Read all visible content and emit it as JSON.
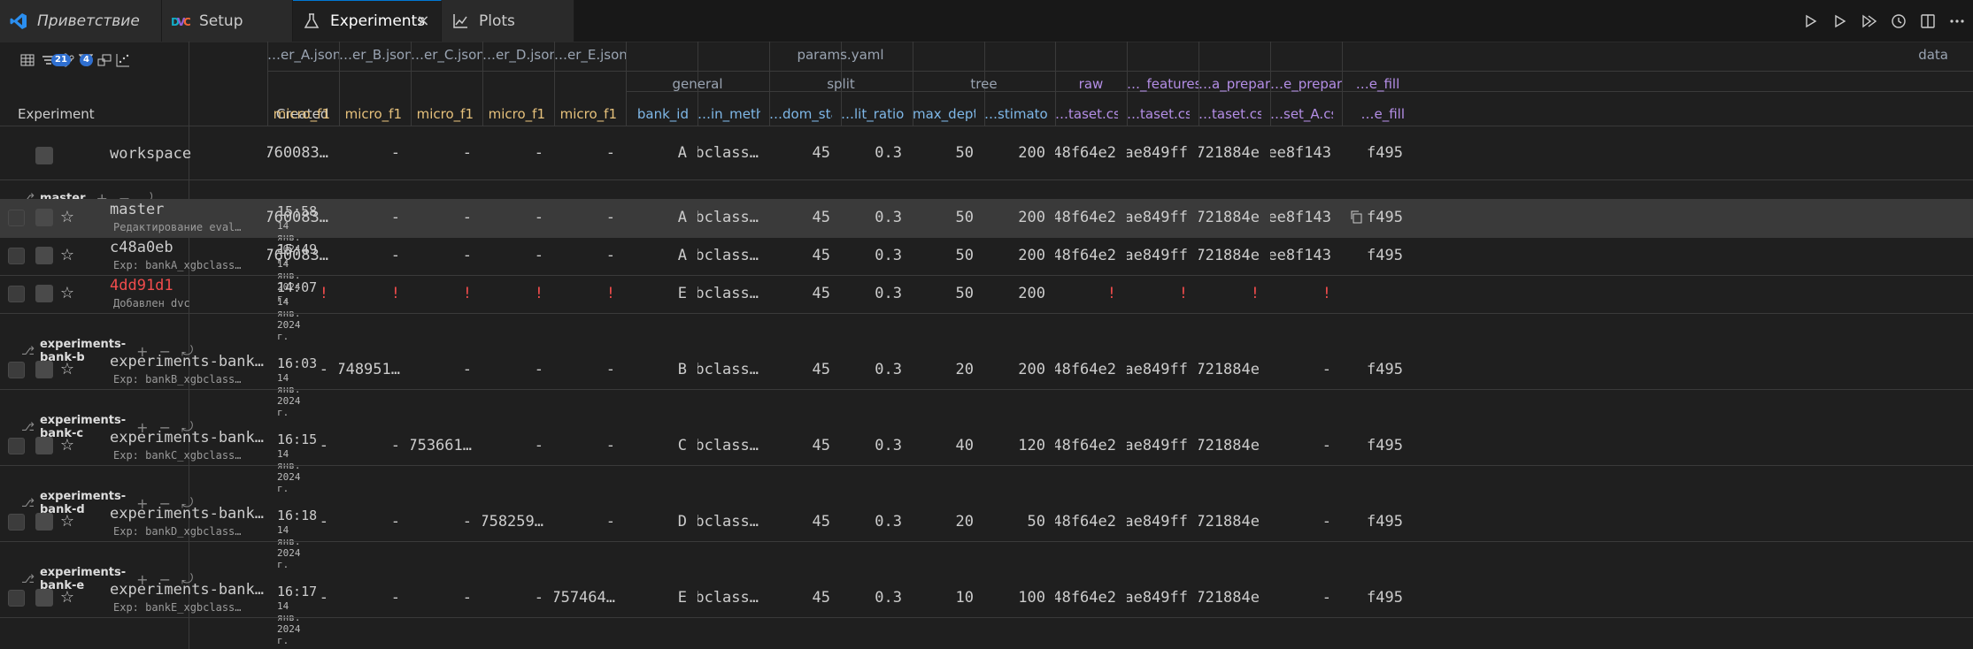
{
  "tabs": [
    {
      "label": "Приветствие",
      "icon": "vscode-icon"
    },
    {
      "label": "Setup",
      "icon": "dvc-icon"
    },
    {
      "label": "Experiments",
      "icon": "beaker-icon",
      "close": "×"
    },
    {
      "label": "Plots",
      "icon": "chart-icon"
    }
  ],
  "toolbar": {
    "filter_badge": "21",
    "branch_badge": "4"
  },
  "header": {
    "experiment": "Experiment",
    "created": "Created",
    "files": [
      "…er_A.json",
      "…er_B.json",
      "…er_C.json",
      "…er_D.json",
      "…er_E.json"
    ],
    "params_file": "params.yaml",
    "data_file": "data",
    "param_groups": [
      "general",
      "split",
      "tree"
    ],
    "dep_groups": [
      "raw",
      "…_features",
      "…a_prepare",
      "…e_prepare",
      "…e_fill"
    ],
    "columns": [
      "micro_f1",
      "micro_f1",
      "micro_f1",
      "micro_f1",
      "micro_f1",
      "bank_id",
      "…in_method",
      "…dom_state",
      "…lit_ratio",
      "max_depth",
      "…stimators",
      "…taset.csv",
      "…taset.csv",
      "…taset.csv",
      "…set_A.csv",
      "…e_fill"
    ]
  },
  "workspace": {
    "label": "workspace",
    "values": [
      "0.760083…",
      "-",
      "-",
      "-",
      "-",
      "A",
      "xgbclass…",
      "45",
      "0.3",
      "50",
      "200",
      "48f64e2",
      "ae849ff",
      "721884e",
      "ee8f143",
      "f495"
    ]
  },
  "groups": [
    {
      "branch": "master",
      "rows": [
        {
          "label": "master",
          "sub": "Редактирование eval…",
          "time": "15:58",
          "date": "14 янв. 2024 г.",
          "values": [
            "0.760083…",
            "-",
            "-",
            "-",
            "-",
            "A",
            "xgbclass…",
            "45",
            "0.3",
            "50",
            "200",
            "48f64e2",
            "ae849ff",
            "721884e",
            "ee8f143",
            "f495"
          ]
        },
        {
          "label": "c48a0eb",
          "sub": "Exp: bankA_xgbclass…",
          "time": "15:49",
          "date": "14 янв. 2024 г.",
          "values": [
            "0.760083…",
            "-",
            "-",
            "-",
            "-",
            "A",
            "xgbclass…",
            "45",
            "0.3",
            "50",
            "200",
            "48f64e2",
            "ae849ff",
            "721884e",
            "ee8f143",
            "f495"
          ]
        },
        {
          "label": "4dd91d1",
          "sub": "Добавлен dvc",
          "time": "14:07",
          "date": "14 янв. 2024 г.",
          "values": [
            "!",
            "!",
            "!",
            "!",
            "!",
            "E",
            "xgbclass…",
            "45",
            "0.3",
            "50",
            "200",
            "!",
            "!",
            "!",
            "!",
            ""
          ]
        }
      ]
    },
    {
      "branch": "experiments-bank-b",
      "rows": [
        {
          "label": "experiments-bank…",
          "sub": "Exp: bankB_xgbclass…",
          "time": "16:03",
          "date": "14 янв. 2024 г.",
          "values": [
            "-",
            "0.748951…",
            "-",
            "-",
            "-",
            "B",
            "xgbclass…",
            "45",
            "0.3",
            "20",
            "200",
            "48f64e2",
            "ae849ff",
            "721884e",
            "-",
            "f495"
          ]
        }
      ]
    },
    {
      "branch": "experiments-bank-c",
      "rows": [
        {
          "label": "experiments-bank…",
          "sub": "Exp: bankC_xgbclass…",
          "time": "16:15",
          "date": "14 янв. 2024 г.",
          "values": [
            "-",
            "-",
            "0.753661…",
            "-",
            "-",
            "C",
            "xgbclass…",
            "45",
            "0.3",
            "40",
            "120",
            "48f64e2",
            "ae849ff",
            "721884e",
            "-",
            "f495"
          ]
        }
      ]
    },
    {
      "branch": "experiments-bank-d",
      "rows": [
        {
          "label": "experiments-bank…",
          "sub": "Exp: bankD_xgbclass…",
          "time": "16:18",
          "date": "14 янв. 2024 г.",
          "values": [
            "-",
            "-",
            "-",
            "0.758259…",
            "-",
            "D",
            "xgbclass…",
            "45",
            "0.3",
            "20",
            "50",
            "48f64e2",
            "ae849ff",
            "721884e",
            "-",
            "f495"
          ]
        }
      ]
    },
    {
      "branch": "experiments-bank-e",
      "rows": [
        {
          "label": "experiments-bank…",
          "sub": "Exp: bankE_xgbclass…",
          "time": "16:17",
          "date": "14 янв. 2024 г.",
          "values": [
            "-",
            "-",
            "-",
            "-",
            "0.757464…",
            "E",
            "xgbclass…",
            "45",
            "0.3",
            "10",
            "100",
            "48f64e2",
            "ae849ff",
            "721884e",
            "-",
            "f495"
          ]
        }
      ]
    }
  ],
  "colors": {
    "accent": "#0078d4",
    "error": "#f14c4c",
    "metric": "#e5c07b",
    "param": "#7fb8e8",
    "dep": "#b48ee6",
    "highlight": "#3a3a3a"
  }
}
